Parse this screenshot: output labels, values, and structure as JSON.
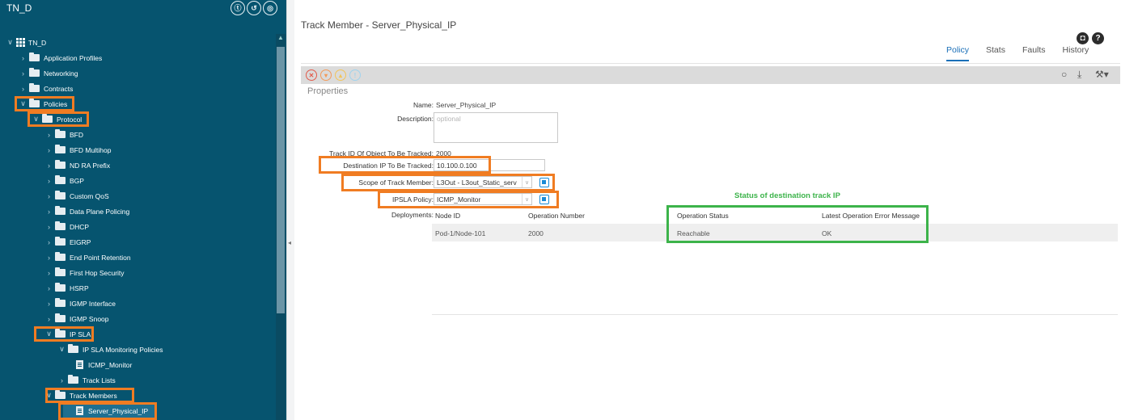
{
  "sidebar": {
    "title": "TN_D",
    "header_icons": [
      "filter-icon",
      "back-icon",
      "settings-icon"
    ],
    "tree": [
      {
        "label": "TN_D",
        "icon": "tenant-grid-icon",
        "expanded": true
      },
      {
        "label": "Application Profiles",
        "icon": "folder-icon",
        "expanded": false
      },
      {
        "label": "Networking",
        "icon": "folder-icon",
        "expanded": false
      },
      {
        "label": "Contracts",
        "icon": "folder-icon",
        "expanded": false
      },
      {
        "label": "Policies",
        "icon": "folder-icon",
        "expanded": true,
        "highlighted": true
      },
      {
        "label": "Protocol",
        "icon": "folder-icon",
        "expanded": true,
        "highlighted": true
      },
      {
        "label": "BFD",
        "icon": "folder-icon",
        "expanded": false
      },
      {
        "label": "BFD Multihop",
        "icon": "folder-icon",
        "expanded": false
      },
      {
        "label": "ND RA Prefix",
        "icon": "folder-icon",
        "expanded": false
      },
      {
        "label": "BGP",
        "icon": "folder-icon",
        "expanded": false
      },
      {
        "label": "Custom QoS",
        "icon": "folder-icon",
        "expanded": false
      },
      {
        "label": "Data Plane Policing",
        "icon": "folder-icon",
        "expanded": false
      },
      {
        "label": "DHCP",
        "icon": "folder-icon",
        "expanded": false
      },
      {
        "label": "EIGRP",
        "icon": "folder-icon",
        "expanded": false
      },
      {
        "label": "End Point Retention",
        "icon": "folder-icon",
        "expanded": false
      },
      {
        "label": "First Hop Security",
        "icon": "folder-icon",
        "expanded": false
      },
      {
        "label": "HSRP",
        "icon": "folder-icon",
        "expanded": false
      },
      {
        "label": "IGMP Interface",
        "icon": "folder-icon",
        "expanded": false
      },
      {
        "label": "IGMP Snoop",
        "icon": "folder-icon",
        "expanded": false
      },
      {
        "label": "IP SLA",
        "icon": "folder-icon",
        "expanded": true,
        "highlighted": true
      },
      {
        "label": "IP SLA Monitoring Policies",
        "icon": "folder-icon",
        "expanded": true
      },
      {
        "label": "ICMP_Monitor",
        "icon": "document-icon"
      },
      {
        "label": "Track Lists",
        "icon": "folder-icon",
        "expanded": false
      },
      {
        "label": "Track Members",
        "icon": "folder-icon",
        "expanded": true,
        "highlighted": true
      },
      {
        "label": "Server_Physical_IP",
        "icon": "document-icon",
        "selected": true,
        "highlighted": true
      }
    ]
  },
  "main": {
    "title": "Track Member - Server_Physical_IP",
    "tabs": [
      "Policy",
      "Stats",
      "Faults",
      "History"
    ],
    "active_tab": "Policy",
    "properties_label": "Properties",
    "fields": {
      "name_label": "Name:",
      "name_value": "Server_Physical_IP",
      "description_label": "Description:",
      "description_placeholder": "optional",
      "track_id_label": "Track ID Of Object To Be Tracked:",
      "track_id_value": "2000",
      "dest_ip_label": "Destination IP To Be Tracked:",
      "dest_ip_value": "10.100.0.100",
      "scope_label": "Scope of Track Member:",
      "scope_value": "L3Out - L3out_Static_serv",
      "ipsla_label": "IPSLA Policy:",
      "ipsla_value": "ICMP_Monitor",
      "deployments_label": "Deployments:"
    },
    "annotation": "Status of destination track IP",
    "table": {
      "columns": [
        "Node ID",
        "Operation Number",
        "Operation Status",
        "Latest Operation Error Message"
      ],
      "rows": [
        [
          "Pod-1/Node-101",
          "2000",
          "Reachable",
          "OK"
        ]
      ]
    }
  },
  "colors": {
    "sidebar_bg": "#06546f",
    "highlight_orange": "#f07c22",
    "highlight_green": "#3cb34a",
    "tab_active": "#1a6fb8"
  }
}
